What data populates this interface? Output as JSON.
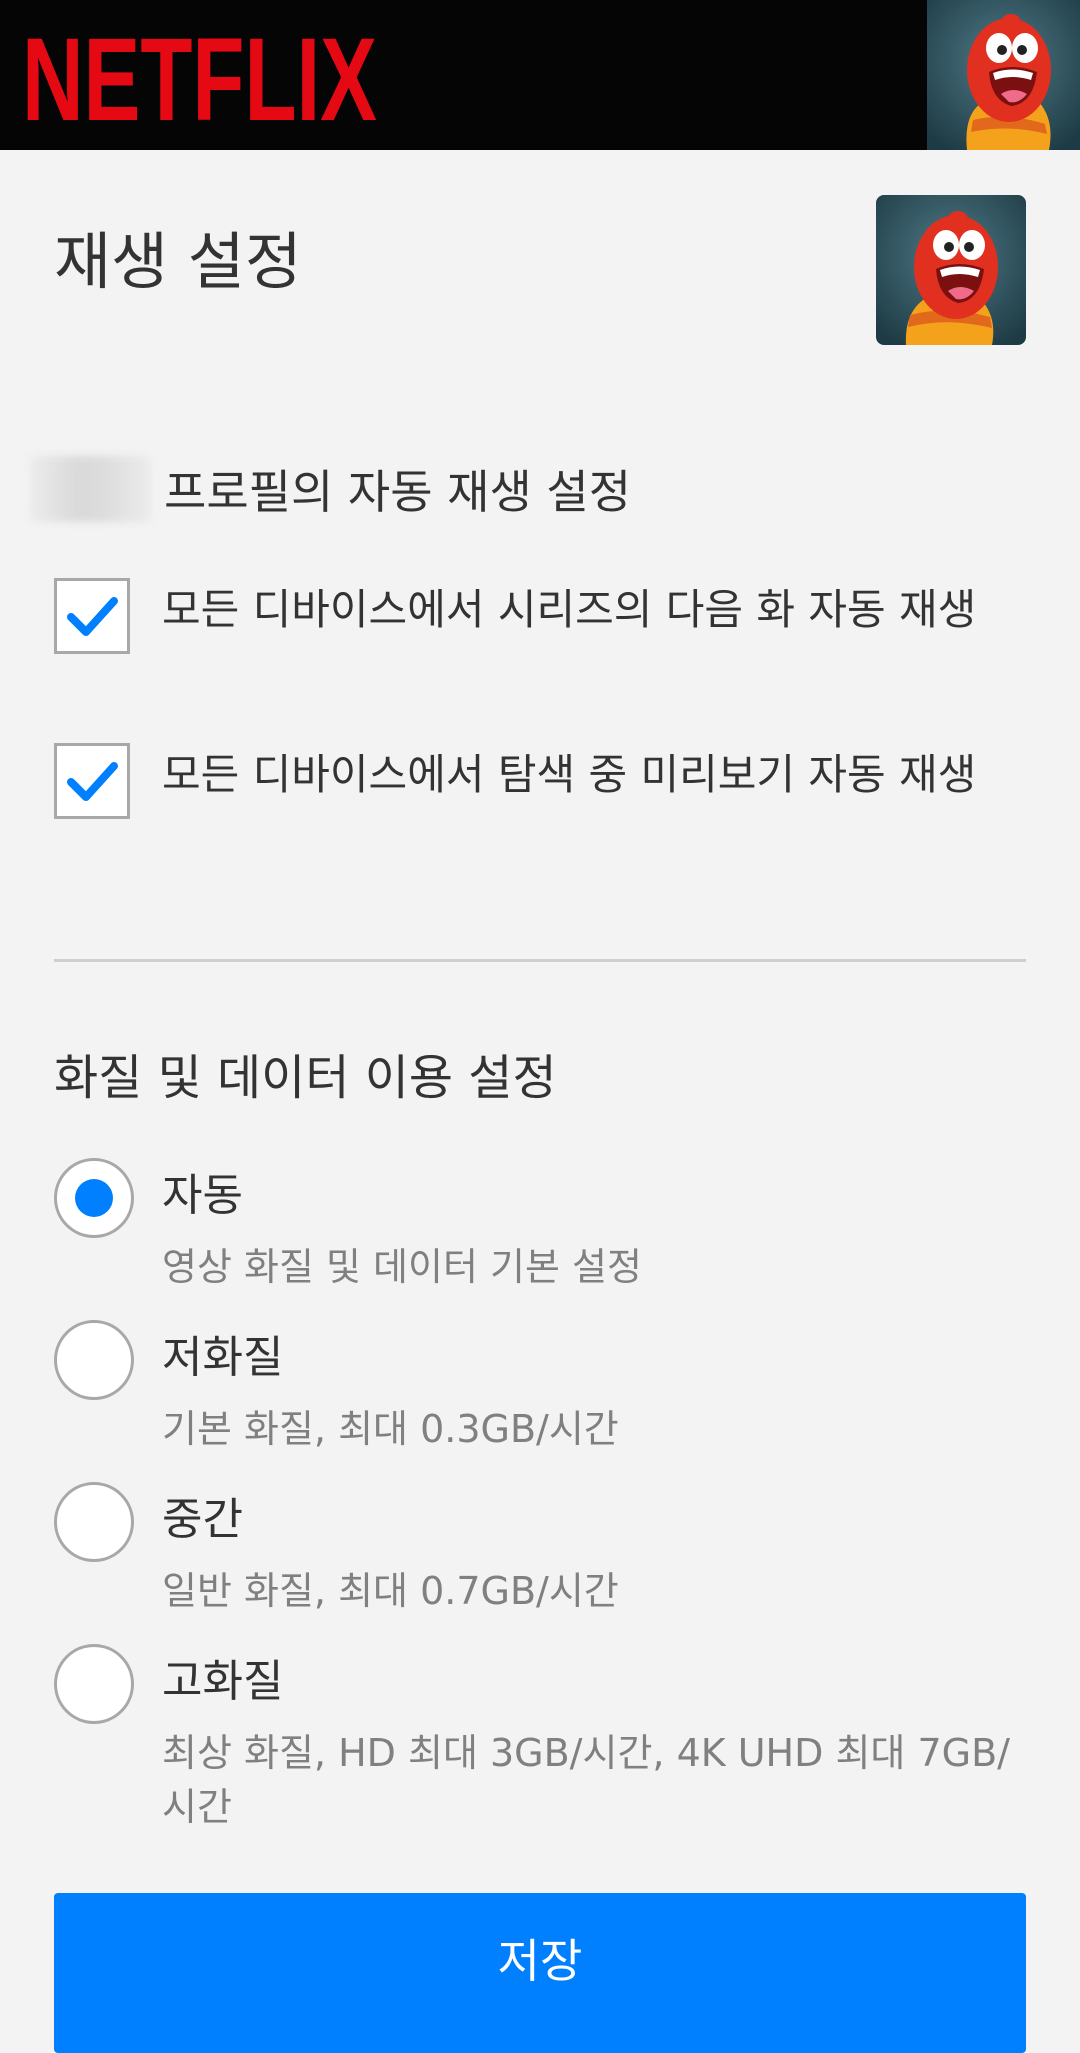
{
  "header": {
    "logo_text": "NETFLIX",
    "logo_color": "#e50914"
  },
  "page": {
    "title": "재생 설정"
  },
  "autoplay": {
    "heading_suffix": "프로필의 자동 재생 설정",
    "options": [
      {
        "label": "모든 디바이스에서 시리즈의 다음 화 자동 재생",
        "checked": true
      },
      {
        "label": "모든 디바이스에서 탐색 중 미리보기 자동 재생",
        "checked": true
      }
    ]
  },
  "quality": {
    "heading": "화질 및 데이터 이용 설정",
    "options": [
      {
        "label": "자동",
        "description": "영상 화질 및 데이터 기본 설정",
        "selected": true
      },
      {
        "label": "저화질",
        "description": "기본 화질, 최대 0.3GB/시간",
        "selected": false
      },
      {
        "label": "중간",
        "description": "일반 화질, 최대 0.7GB/시간",
        "selected": false
      },
      {
        "label": "고화질",
        "description": "최상 화질, HD 최대 3GB/시간, 4K UHD 최대 7GB/시간",
        "selected": false
      }
    ]
  },
  "actions": {
    "save_label": "저장"
  },
  "colors": {
    "accent": "#0080ff",
    "header_bg": "#050505",
    "page_bg": "#f3f3f3"
  }
}
